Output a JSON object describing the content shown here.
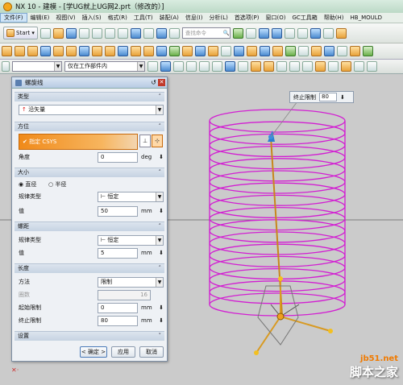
{
  "app": {
    "title": "NX 10 - 建模 - [学UG就上UG网2.prt（修改的）]"
  },
  "menubar": {
    "items": [
      "文件(F)",
      "编辑(E)",
      "视图(V)",
      "插入(S)",
      "格式(R)",
      "工具(T)",
      "装配(A)",
      "信息(I)",
      "分析(L)",
      "首选项(P)",
      "窗口(O)",
      "GC工具箱",
      "帮助(H)",
      "HB_MOULD"
    ]
  },
  "toolbar": {
    "start_label": "Start ▾",
    "search_placeholder": "查找命令"
  },
  "selection_bar": {
    "filter_value": "仅在工作部件内"
  },
  "hud": {
    "label": "终止限制",
    "value": "80"
  },
  "dialog": {
    "title": "螺旋线",
    "sections": {
      "type": {
        "label": "类型",
        "value": "沿矢量"
      },
      "orientation": {
        "label": "方位",
        "csys_label": "指定 CSYS",
        "angle_label": "角度",
        "angle_value": "0",
        "angle_unit": "deg"
      },
      "size": {
        "label": "大小",
        "diameter_label": "直径",
        "radius_label": "半径",
        "law_label": "规律类型",
        "law_value": "恒定",
        "value_label": "值",
        "value": "50",
        "unit": "mm"
      },
      "pitch": {
        "label": "螺距",
        "law_label": "规律类型",
        "law_value": "恒定",
        "value_label": "值",
        "value": "5",
        "unit": "mm"
      },
      "length": {
        "label": "长度",
        "method_label": "方法",
        "method_value": "限制",
        "turns_label": "圈数",
        "turns_value": "16",
        "start_label": "起始限制",
        "start_value": "0",
        "end_label": "终止限制",
        "end_value": "80",
        "unit": "mm"
      },
      "settings": {
        "label": "设置"
      }
    },
    "buttons": {
      "ok": "< 确定 >",
      "apply": "应用",
      "cancel": "取消"
    }
  },
  "watermark": {
    "line1": "jb51.net",
    "line2": "脚本之家"
  },
  "colors": {
    "helix": "#d21fd2",
    "accent_orange": "#f08a1a",
    "arrow_red": "#e0201f"
  }
}
